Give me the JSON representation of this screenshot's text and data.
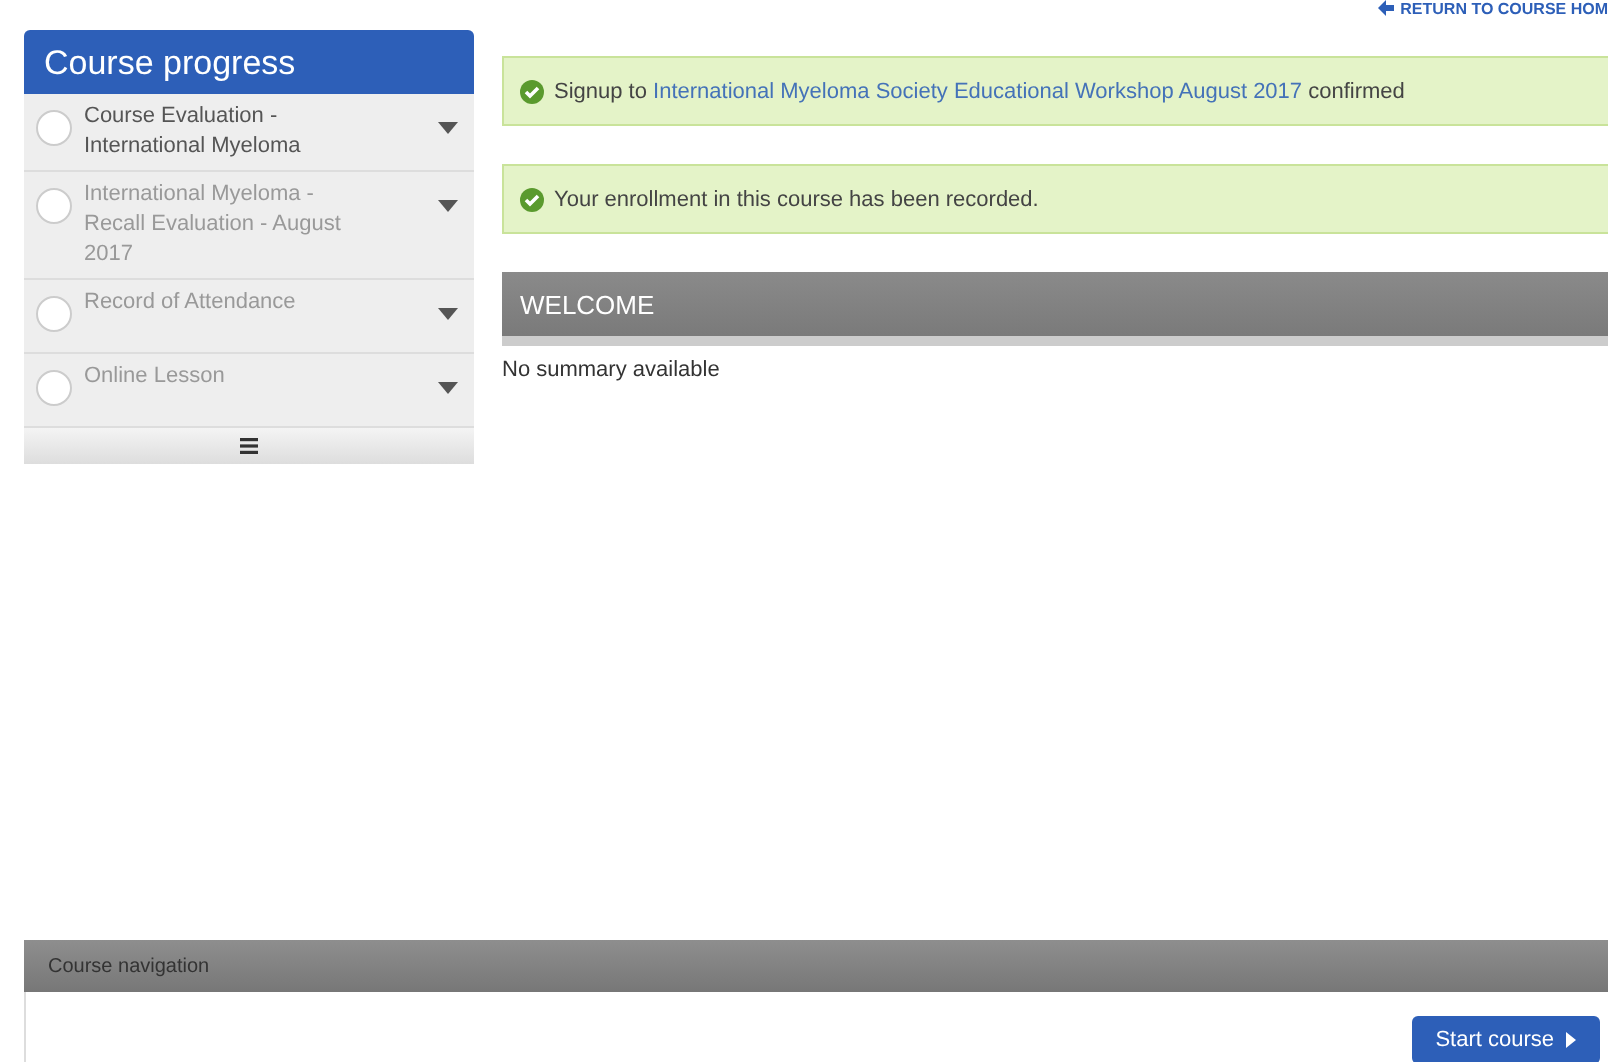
{
  "sidebar": {
    "title": "Course progress",
    "items": [
      {
        "label": "Course Evaluation - International Myeloma",
        "disabled": false,
        "checked": false
      },
      {
        "label": "International Myeloma - Recall Evaluation - August 2017",
        "disabled": true,
        "checked": false
      },
      {
        "label": "Record of Attendance",
        "disabled": true,
        "checked": false
      },
      {
        "label": "Online Lesson",
        "disabled": true,
        "checked": false
      }
    ]
  },
  "return_link": "RETURN TO COURSE HOM",
  "alerts": [
    {
      "prefix": "Signup to",
      "link": "International Myeloma Society Educational Workshop August 2017",
      "suffix": "confirmed"
    },
    {
      "prefix": "Your enrollment in this course has been recorded."
    }
  ],
  "welcome": {
    "title": "WELCOME",
    "summary": "No summary available"
  },
  "navigation": {
    "title": "Course navigation",
    "button": "Start course"
  }
}
